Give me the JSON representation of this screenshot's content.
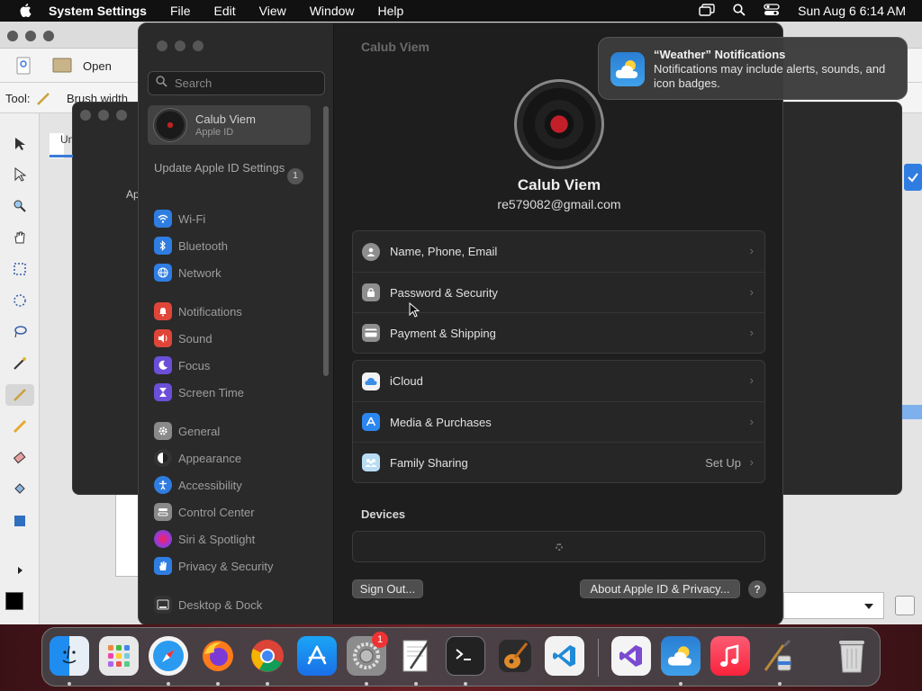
{
  "menubar": {
    "app_name": "System Settings",
    "menus": [
      "File",
      "Edit",
      "View",
      "Window",
      "Help"
    ],
    "clock": "Sun Aug 6  6:14 AM"
  },
  "background_app": {
    "open_label": "Open",
    "tool_label": "Tool:",
    "brush_label": "Brush width",
    "tab_label": "Un",
    "side_label": "Ap"
  },
  "settings": {
    "window_title": "Calub Viem",
    "search": {
      "placeholder": "Search"
    },
    "profile": {
      "name": "Calub Viem",
      "subtitle": "Apple ID"
    },
    "update": {
      "label": "Update Apple ID Settings",
      "count": "1"
    },
    "sidebar_items": [
      {
        "label": "Wi-Fi",
        "color": "#2f7de1"
      },
      {
        "label": "Bluetooth",
        "color": "#2f7de1"
      },
      {
        "label": "Network",
        "color": "#2f7de1"
      },
      {
        "label": "Notifications",
        "color": "#e0453a"
      },
      {
        "label": "Sound",
        "color": "#e0453a"
      },
      {
        "label": "Focus",
        "color": "#6b4fd8"
      },
      {
        "label": "Screen Time",
        "color": "#6b4fd8"
      },
      {
        "label": "General",
        "color": "#8a8a8a"
      },
      {
        "label": "Appearance",
        "color": "#333333"
      },
      {
        "label": "Accessibility",
        "color": "#2f7de1"
      },
      {
        "label": "Control Center",
        "color": "#8a8a8a"
      },
      {
        "label": "Siri & Spotlight",
        "color": "#b0459b"
      },
      {
        "label": "Privacy & Security",
        "color": "#2f7de1"
      },
      {
        "label": "Desktop & Dock",
        "color": "#333333"
      }
    ],
    "account": {
      "name": "Calub Viem",
      "email": "re579082@gmail.com",
      "group1": [
        "Name, Phone, Email",
        "Password & Security",
        "Payment & Shipping"
      ],
      "group2": [
        "iCloud",
        "Media & Purchases",
        "Family Sharing"
      ],
      "family_action": "Set Up",
      "devices_heading": "Devices",
      "sign_out": "Sign Out...",
      "about": "About Apple ID & Privacy...",
      "help": "?"
    }
  },
  "notification": {
    "title": "“Weather” Notifications",
    "body": "Notifications may include alerts, sounds, and icon badges."
  },
  "dock": {
    "apps": [
      "Finder",
      "Launchpad",
      "Safari",
      "Firefox",
      "Chrome",
      "App Store",
      "System Settings",
      "TextEdit",
      "Terminal",
      "GarageBand",
      "VS Code",
      "Visual Studio",
      "Weather",
      "Music",
      "Paintbrush",
      "Trash"
    ],
    "badge": "1"
  }
}
